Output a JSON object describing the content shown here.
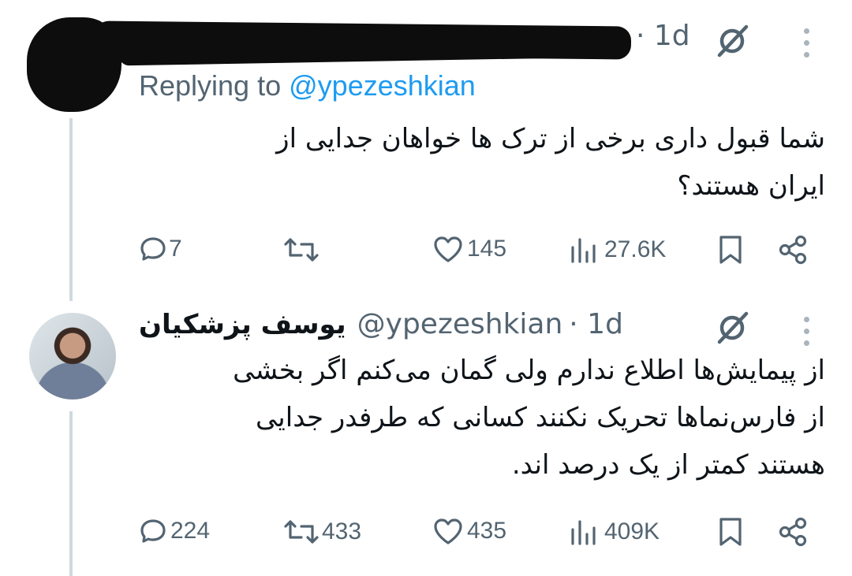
{
  "reply_tweet": {
    "timestamp": "· 1d",
    "replying_prefix": "Replying to",
    "replying_handle": "@ypezeshkian",
    "text_line1": "شما قبول داری برخی از ترک ها خواهان جدایی از",
    "text_line2": "ایران هستند؟",
    "replies": "7",
    "retweets": "",
    "likes": "145",
    "views": "27.6K"
  },
  "main_tweet": {
    "display_name": "یوسف پزشکیان",
    "handle": "@ypezeshkian",
    "timestamp": "· 1d",
    "text_line1": "از پیمایش‌ها اطلاع ندارم ولی گمان می‌کنم اگر بخشی",
    "text_line2": "از فارس‌نماها تحریک نکنند کسانی که طرفدر جدایی",
    "text_line3": "هستند کمتر از یک درصد اند.",
    "replies": "224",
    "retweets": "433",
    "likes": "435",
    "views": "409K"
  },
  "icons": {
    "grok": "slashed-circle-icon",
    "more": "more-vertical-icon",
    "reply": "reply-bubble-icon",
    "retweet": "retweet-icon",
    "like": "heart-icon",
    "views": "views-bars-icon",
    "bookmark": "bookmark-icon",
    "share": "share-icon"
  },
  "colors": {
    "text": "#0f1419",
    "secondary": "#536471",
    "link": "#1d9bf0",
    "thread_line": "#cfd9de"
  }
}
